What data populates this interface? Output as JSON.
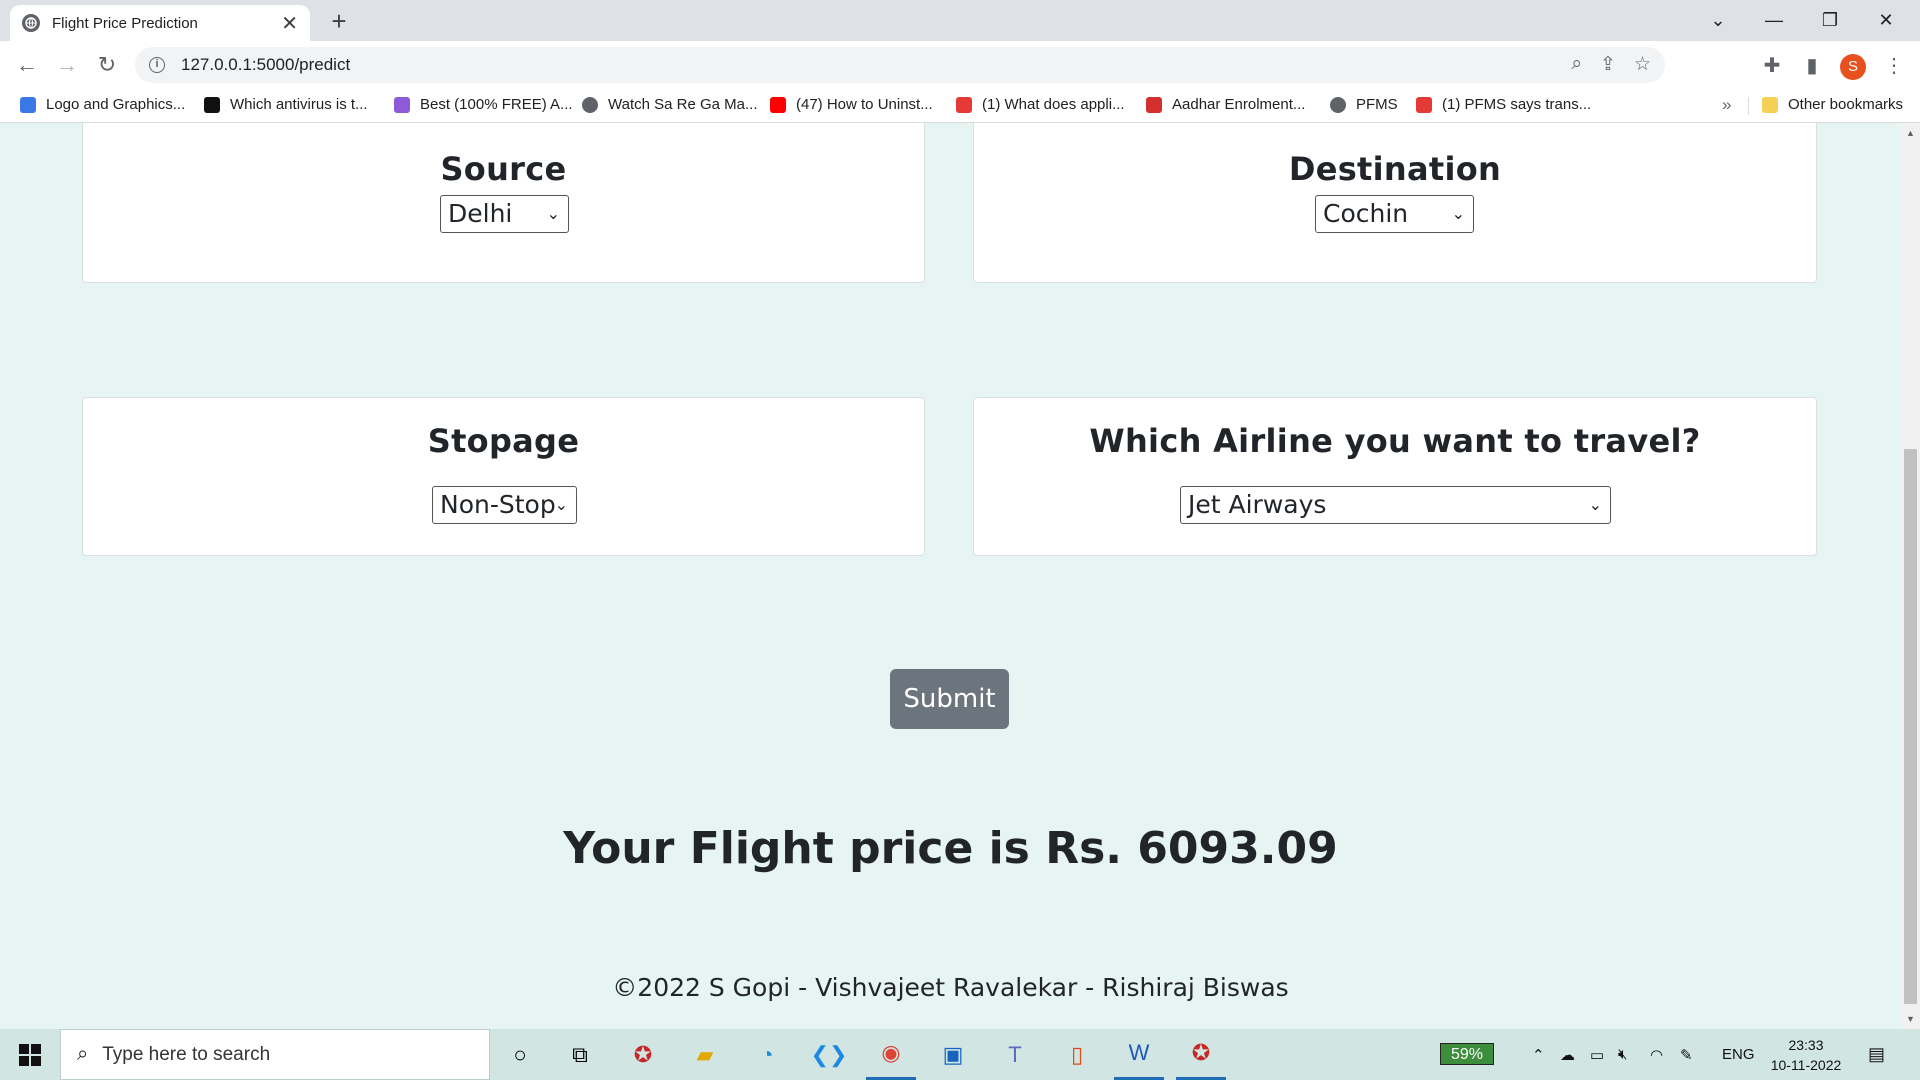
{
  "browser": {
    "tab_title": "Flight Price Prediction",
    "url": "127.0.0.1:5000/predict",
    "profile_initial": "S",
    "bookmarks": [
      {
        "label": "Logo and Graphics...",
        "icon": "graphics-icon",
        "color": "#3b78e7"
      },
      {
        "label": "Which antivirus is t...",
        "icon": "terminal-icon",
        "color": "#111111"
      },
      {
        "label": "Best (100% FREE) A...",
        "icon": "feather-icon",
        "color": "#8e5bd8"
      },
      {
        "label": "Watch Sa Re Ga Ma...",
        "icon": "globe-icon",
        "color": "#5f6368"
      },
      {
        "label": "(47) How to Uninst...",
        "icon": "youtube-icon",
        "color": "#ff0000"
      },
      {
        "label": "(1) What does appli...",
        "icon": "g-icon",
        "color": "#e53935"
      },
      {
        "label": "Aadhar Enrolment...",
        "icon": "aadhar-icon",
        "color": "#d32f2f"
      },
      {
        "label": "PFMS",
        "icon": "globe-icon",
        "color": "#5f6368"
      },
      {
        "label": "(1) PFMS says trans...",
        "icon": "g-icon",
        "color": "#e53935"
      }
    ],
    "other_bookmarks": "Other bookmarks"
  },
  "form": {
    "source_label": "Source",
    "source_value": "Delhi",
    "destination_label": "Destination",
    "destination_value": "Cochin",
    "stopage_label": "Stopage",
    "stopage_value": "Non-Stop",
    "airline_label": "Which Airline you want to travel?",
    "airline_value": "Jet Airways",
    "submit_label": "Submit"
  },
  "result_text": "Your Flight price is Rs. 6093.09",
  "footer_text": "©2022 S Gopi - Vishvajeet Ravalekar - Rishiraj Biswas",
  "taskbar": {
    "search_placeholder": "Type here to search",
    "battery": "59%",
    "language": "ENG",
    "time": "23:33",
    "date": "10-11-2022"
  },
  "colors": {
    "page_bg": "#e6f4f2",
    "submit_bg": "#6c757d",
    "taskbar_bg": "#d1e6e2"
  }
}
